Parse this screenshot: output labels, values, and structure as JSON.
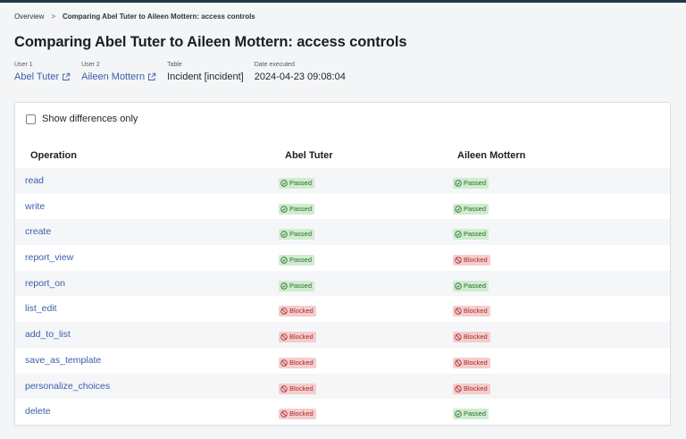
{
  "breadcrumb": {
    "root": "Overview",
    "separator": ">",
    "current": "Comparing Abel Tuter to Aileen Mottern: access controls"
  },
  "page_title": "Comparing Abel Tuter to Aileen Mottern: access controls",
  "meta": {
    "user1_label": "User 1",
    "user1_value": "Abel Tuter",
    "user2_label": "User 2",
    "user2_value": "Aileen Mottern",
    "table_label": "Table",
    "table_value": "Incident [incident]",
    "date_label": "Date executed",
    "date_value": "2024-04-23 09:08:04"
  },
  "filter": {
    "label": "Show differences only",
    "checked": false
  },
  "table": {
    "headers": {
      "operation": "Operation",
      "user1": "Abel Tuter",
      "user2": "Aileen Mottern"
    },
    "rows": [
      {
        "operation": "read",
        "user1": "Passed",
        "user2": "Passed"
      },
      {
        "operation": "write",
        "user1": "Passed",
        "user2": "Passed"
      },
      {
        "operation": "create",
        "user1": "Passed",
        "user2": "Passed"
      },
      {
        "operation": "report_view",
        "user1": "Passed",
        "user2": "Blocked"
      },
      {
        "operation": "report_on",
        "user1": "Passed",
        "user2": "Passed"
      },
      {
        "operation": "list_edit",
        "user1": "Blocked",
        "user2": "Blocked"
      },
      {
        "operation": "add_to_list",
        "user1": "Blocked",
        "user2": "Blocked"
      },
      {
        "operation": "save_as_template",
        "user1": "Blocked",
        "user2": "Blocked"
      },
      {
        "operation": "personalize_choices",
        "user1": "Blocked",
        "user2": "Blocked"
      },
      {
        "operation": "delete",
        "user1": "Blocked",
        "user2": "Passed"
      }
    ]
  },
  "colors": {
    "link": "#3a5ea8",
    "passed_bg": "#cfeccf",
    "passed_text": "#2a6b2a",
    "blocked_bg": "#f6cccc",
    "blocked_text": "#a22d2d"
  },
  "icons": {
    "external_link": "external-link-icon",
    "passed": "check-circle-icon",
    "blocked": "blocked-circle-icon"
  }
}
